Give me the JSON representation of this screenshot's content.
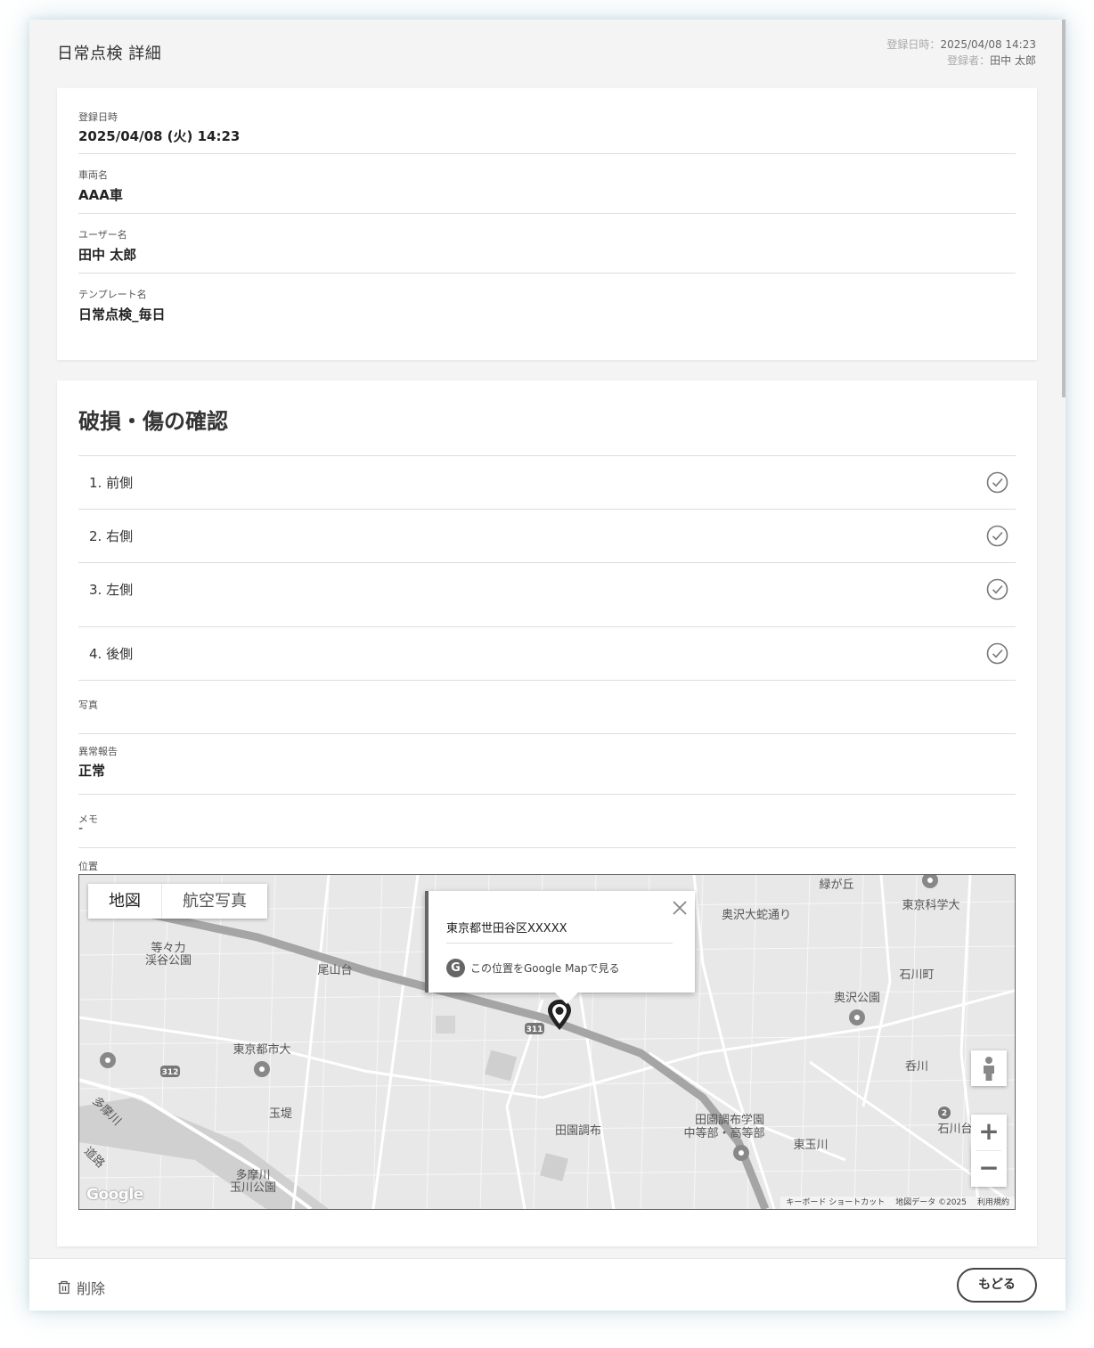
{
  "header": {
    "title": "日常点検 詳細",
    "meta": [
      {
        "label": "登録日時：",
        "value": "2025/04/08 14:23"
      },
      {
        "label": "登録者：",
        "value": "田中 太郎"
      }
    ]
  },
  "info_card": {
    "fields": [
      {
        "label": "登録日時",
        "value": "2025/04/08 (火) 14:23"
      },
      {
        "label": "車両名",
        "value": "AAA車"
      },
      {
        "label": "ユーザー名",
        "value": "田中 太郎"
      },
      {
        "label": "テンプレート名",
        "value": "日常点検_毎日"
      }
    ]
  },
  "section": {
    "title": "破損・傷の確認",
    "items": [
      {
        "label": "1. 前側",
        "checked": true
      },
      {
        "label": "2. 右側",
        "checked": true
      },
      {
        "label": "3. 左側",
        "checked": true
      },
      {
        "label": "4. 後側",
        "checked": true
      }
    ],
    "photo_label": "写真",
    "anomaly_label": "異常報告",
    "anomaly_value": "正常",
    "memo_label": "メモ",
    "memo_value": "-",
    "location_label": "位置"
  },
  "map": {
    "type_buttons": [
      "地図",
      "航空写真"
    ],
    "address": "東京都世田谷区XXXXX",
    "open_link": "この位置をGoogle Mapで見る",
    "google_logo": "Google",
    "footer_links": [
      "キーボード ショートカット",
      "地図データ ©2025",
      "利用規約"
    ],
    "place_labels": {
      "l1": "緑が丘",
      "l2": "東京科学大",
      "l3": "奥沢大蛇通り",
      "l4": "等々力",
      "l5": "渓谷公園",
      "l6": "尾山台",
      "l7": "石川町",
      "l8": "奥沢公園",
      "l9": "東京都市大",
      "l10": "玉堤",
      "l11": "多摩川",
      "l12": "玉川公園",
      "l13": "田園調布",
      "l14": "田園調布学園",
      "l15": "中等部・高等部",
      "l16": "東玉川",
      "l17": "呑川",
      "l18": "石川台",
      "l19": "多摩川",
      "l20": "道路",
      "route1": "311",
      "route2": "312",
      "route3": "2"
    },
    "zoom_in": "+",
    "zoom_out": "−"
  },
  "footer": {
    "delete_label": "削除",
    "back_label": "もどる"
  }
}
